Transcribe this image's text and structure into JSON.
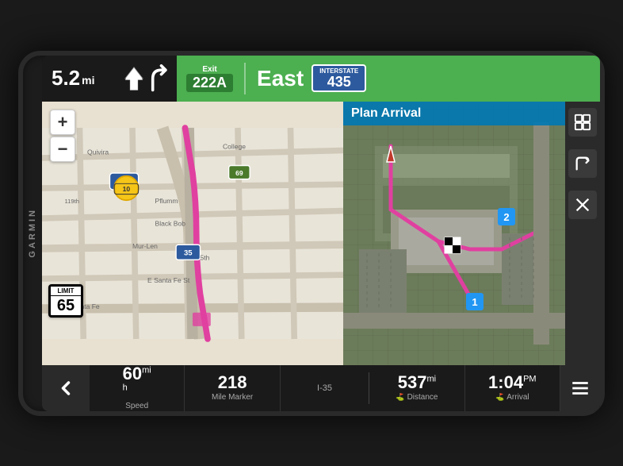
{
  "device": {
    "brand": "GARMIN"
  },
  "nav_bar": {
    "distance": "5.2",
    "distance_unit": "mi",
    "exit_label": "Exit",
    "exit_number": "222A",
    "direction": "East",
    "interstate_label": "INTERSTATE",
    "interstate_number": "435"
  },
  "map_left": {
    "zoom_plus": "+",
    "zoom_minus": "−",
    "speed_limit_label": "LIMIT",
    "speed_limit": "65",
    "route_numbers": [
      "435",
      "10",
      "35"
    ]
  },
  "map_right": {
    "plan_arrival_label": "Plan Arrival",
    "waypoints": [
      "1",
      "2"
    ]
  },
  "right_panel": {
    "map_icon": "🗺",
    "route_icon": "↱",
    "close_icon": "✕"
  },
  "bottom_bar": {
    "back_icon": "‹",
    "speed_value": "60",
    "speed_unit": "mi/h",
    "speed_label": "Speed",
    "mile_marker_value": "218",
    "mile_marker_label": "Mile Marker",
    "road_label": "I-35",
    "distance_value": "537",
    "distance_unit": "mi",
    "distance_label": "Distance",
    "arrival_value": "1:04",
    "arrival_unit": "PM",
    "arrival_label": "Arrival",
    "menu_icon": "≡"
  }
}
